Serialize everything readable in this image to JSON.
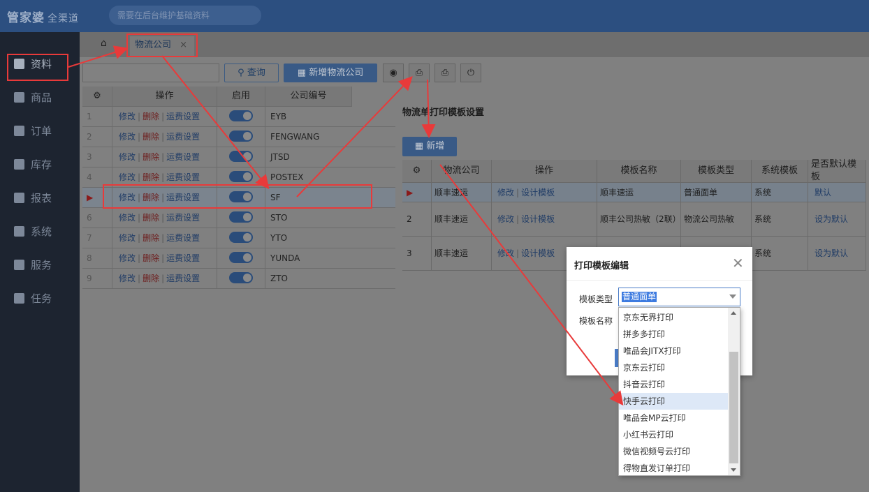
{
  "app": {
    "logo": "管家婆",
    "logo_sub": "全渠道",
    "notice": "需要在后台维护基础资料"
  },
  "sidebar": {
    "items": [
      {
        "label": "资料",
        "icon": "document-icon"
      },
      {
        "label": "商品",
        "icon": "box-icon"
      },
      {
        "label": "订单",
        "icon": "clipboard-icon"
      },
      {
        "label": "库存",
        "icon": "warehouse-icon"
      },
      {
        "label": "报表",
        "icon": "chart-icon"
      },
      {
        "label": "系统",
        "icon": "monitor-icon"
      },
      {
        "label": "服务",
        "icon": "grid-icon"
      },
      {
        "label": "任务",
        "icon": "list-icon"
      }
    ]
  },
  "tabs": {
    "active": "物流公司"
  },
  "toolbar": {
    "query": "查询",
    "add": "新增物流公司"
  },
  "grid1": {
    "headers": [
      "操作",
      "启用",
      "公司编号"
    ],
    "actions": [
      "修改",
      "删除",
      "运费设置"
    ],
    "rows": [
      {
        "no": "1",
        "code": "EYB"
      },
      {
        "no": "2",
        "code": "FENGWANG"
      },
      {
        "no": "3",
        "code": "JTSD"
      },
      {
        "no": "4",
        "code": "POSTEX"
      },
      {
        "no": "▶",
        "code": "SF"
      },
      {
        "no": "6",
        "code": "STO"
      },
      {
        "no": "7",
        "code": "YTO"
      },
      {
        "no": "8",
        "code": "YUNDA"
      },
      {
        "no": "9",
        "code": "ZTO"
      }
    ]
  },
  "panel": {
    "title": "物流单打印模板设置",
    "add": "新增",
    "headers": [
      "物流公司",
      "操作",
      "模板名称",
      "模板类型",
      "系统模板",
      "是否默认模板"
    ],
    "edit": "修改",
    "design": "设计模板",
    "rows": [
      {
        "no": "▶",
        "company": "顺丰速运",
        "name": "顺丰速运",
        "type": "普通面单",
        "system": "系统",
        "default": "默认"
      },
      {
        "no": "2",
        "company": "顺丰速运",
        "name": "顺丰公司热敏（2联）",
        "type": "物流公司热敏",
        "system": "系统",
        "default": "设为默认"
      },
      {
        "no": "3",
        "company": "顺丰速运",
        "name": "顺丰公司热敏（3",
        "type": "",
        "system": "系统",
        "default": "设为默认"
      }
    ]
  },
  "dialog": {
    "title": "打印模板编辑",
    "type_label": "模板类型",
    "name_label": "模板名称",
    "selected": "普通面单",
    "options": [
      "京东无界打印",
      "拼多多打印",
      "唯品会JITX打印",
      "京东云打印",
      "抖音云打印",
      "快手云打印",
      "唯品会MP云打印",
      "小红书云打印",
      "微信视频号云打印",
      "得物直发订单打印"
    ],
    "highlighted": "快手云打印"
  },
  "colors": {
    "annotation": "#e83a3a",
    "accent": "#3d7be0"
  }
}
